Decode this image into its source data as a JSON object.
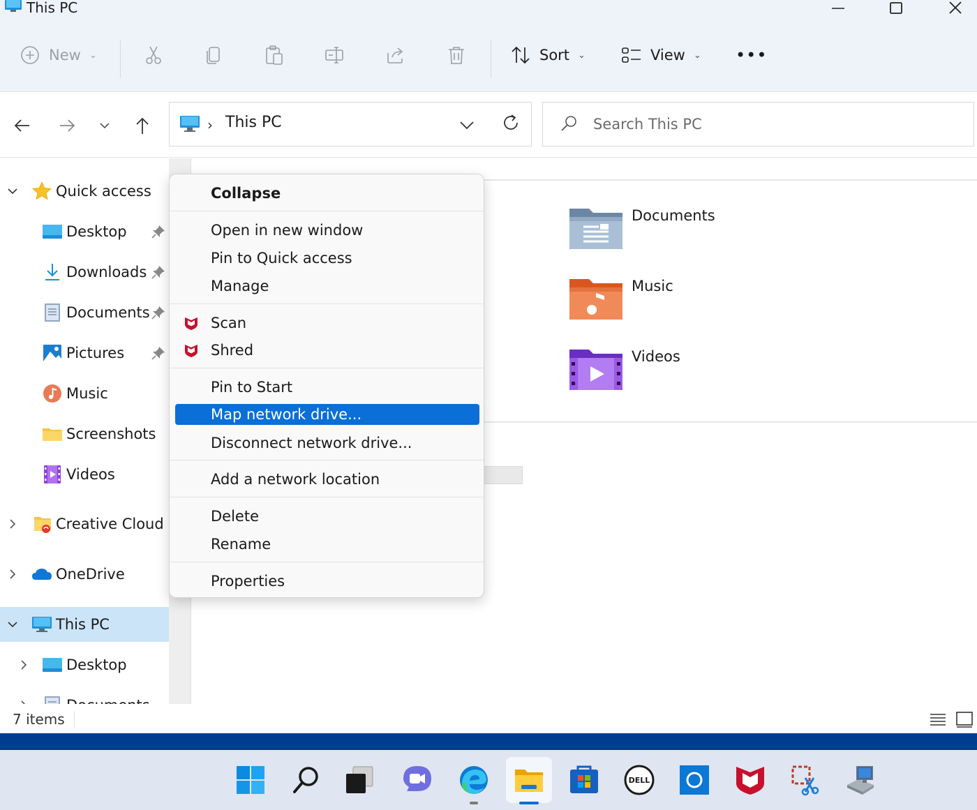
{
  "window": {
    "title": "This PC"
  },
  "commandbar": {
    "new_label": "New",
    "sort_label": "Sort",
    "view_label": "View",
    "more_label": "•••"
  },
  "navbar": {
    "breadcrumb": "This PC",
    "search_placeholder": "Search This PC"
  },
  "sidebar": {
    "items": [
      {
        "label": "Quick access"
      },
      {
        "label": "Desktop"
      },
      {
        "label": "Downloads"
      },
      {
        "label": "Documents"
      },
      {
        "label": "Pictures"
      },
      {
        "label": "Music"
      },
      {
        "label": "Screenshots"
      },
      {
        "label": "Videos"
      },
      {
        "label": "Creative Cloud Fi"
      },
      {
        "label": "OneDrive"
      },
      {
        "label": "This PC"
      },
      {
        "label": "Desktop"
      },
      {
        "label": "Documents"
      }
    ]
  },
  "content": {
    "folders": [
      {
        "name": "Documents"
      },
      {
        "name": "Music"
      },
      {
        "name": "Videos"
      }
    ]
  },
  "context_menu": {
    "items": [
      {
        "label": "Collapse"
      },
      {
        "label": "Open in new window"
      },
      {
        "label": "Pin to Quick access"
      },
      {
        "label": "Manage"
      },
      {
        "label": "Scan"
      },
      {
        "label": "Shred"
      },
      {
        "label": "Pin to Start"
      },
      {
        "label": "Map network drive..."
      },
      {
        "label": "Disconnect network drive..."
      },
      {
        "label": "Add a network location"
      },
      {
        "label": "Delete"
      },
      {
        "label": "Rename"
      },
      {
        "label": "Properties"
      }
    ],
    "highlighted": "Map network drive..."
  },
  "statusbar": {
    "item_count": "7 items"
  },
  "colors": {
    "accent": "#0a6fd6",
    "selected_bg": "#cce4f7",
    "taskbar_accent": "#003c8f",
    "mcafee_red": "#c8102e"
  },
  "taskbar": {
    "icons": [
      "windows-start-icon",
      "search-icon",
      "task-view-icon",
      "teams-chat-icon",
      "edge-icon",
      "file-explorer-icon",
      "microsoft-store-icon",
      "dell-icon",
      "cortana-icon",
      "mcafee-icon",
      "snipping-tool-icon",
      "network-computer-icon"
    ]
  }
}
